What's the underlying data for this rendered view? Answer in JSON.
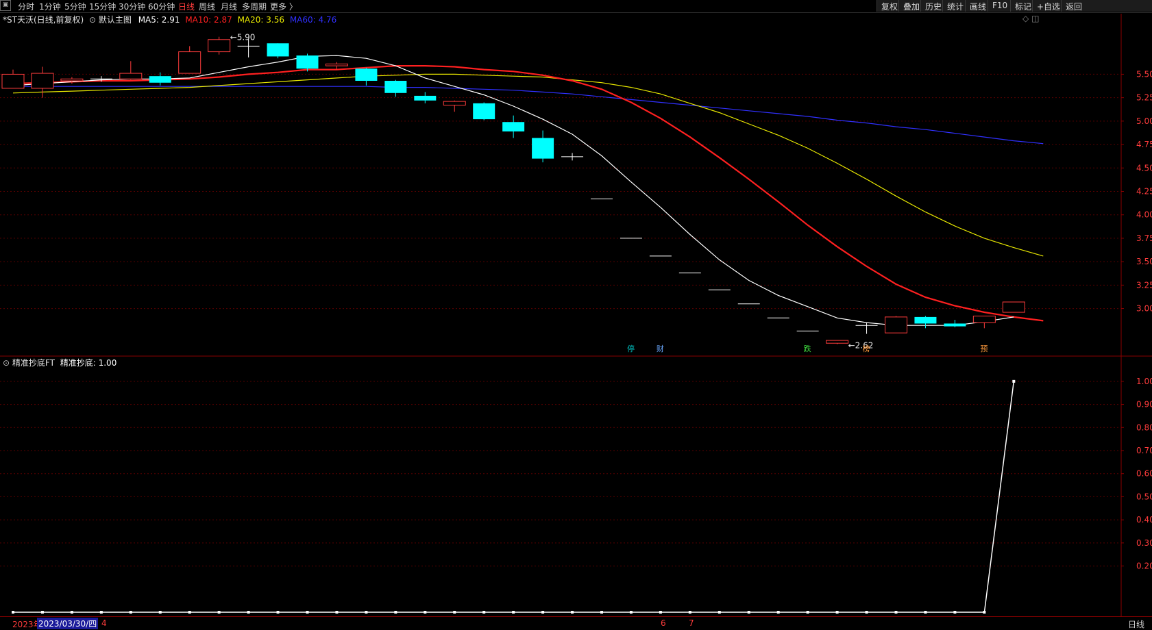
{
  "toolbar": {
    "corner_icon": "panel-toggle-icon",
    "periods": [
      "分时",
      "1分钟",
      "5分钟",
      "15分钟",
      "30分钟",
      "60分钟",
      "日线",
      "周线",
      "月线",
      "多周期",
      "更多 〉"
    ],
    "active_period": "日线",
    "right_buttons": [
      "复权",
      "叠加",
      "历史",
      "统计",
      "画线",
      "F10",
      "标记",
      "+自选",
      "返回"
    ]
  },
  "main_chart": {
    "stock_title": "*ST天沃(日线,前复权)",
    "template_label": "默认主图",
    "ma5": "MA5: 2.91",
    "ma10": "MA10: 2.87",
    "ma20": "MA20: 3.56",
    "ma60": "MA60: 4.76",
    "colors": {
      "ma5": "#ffffff",
      "ma10": "#ff2020",
      "ma20": "#e8e800",
      "ma60": "#3030ff",
      "up": "#ff3c3c",
      "down": "#00ffff",
      "flat": "#ffffff"
    },
    "high_label": "5.90",
    "low_label": "2.62",
    "axis_ticks": [
      "5.50",
      "5.25",
      "5.00",
      "4.75",
      "4.50",
      "4.25",
      "4.00",
      "3.75",
      "3.50",
      "3.25",
      "3.00"
    ],
    "event_markers": [
      {
        "text": "停",
        "color": "#00c0c0"
      },
      {
        "text": "财",
        "color": "#6aa8ff"
      },
      {
        "text": "跌",
        "color": "#40e040"
      },
      {
        "text": "榜",
        "color": "#ff9a3c"
      },
      {
        "text": "预",
        "color": "#ff9a3c"
      }
    ]
  },
  "chart_data": [
    {
      "type": "candlestick",
      "title": "*ST天沃(日线,前复权)",
      "ylim": [
        2.5,
        6.0
      ],
      "candles": [
        {
          "o": 5.35,
          "h": 5.55,
          "l": 5.35,
          "c": 5.5
        },
        {
          "o": 5.35,
          "h": 5.58,
          "l": 5.25,
          "c": 5.51
        },
        {
          "o": 5.43,
          "h": 5.47,
          "l": 5.4,
          "c": 5.45
        },
        {
          "o": 5.45,
          "h": 5.48,
          "l": 5.42,
          "c": 5.45
        },
        {
          "o": 5.45,
          "h": 5.64,
          "l": 5.44,
          "c": 5.51
        },
        {
          "o": 5.48,
          "h": 5.52,
          "l": 5.38,
          "c": 5.41
        },
        {
          "o": 5.51,
          "h": 5.8,
          "l": 5.51,
          "c": 5.74
        },
        {
          "o": 5.74,
          "h": 5.9,
          "l": 5.71,
          "c": 5.87
        },
        {
          "o": 5.8,
          "h": 5.88,
          "l": 5.68,
          "c": 5.8
        },
        {
          "o": 5.83,
          "h": 5.83,
          "l": 5.67,
          "c": 5.69
        },
        {
          "o": 5.7,
          "h": 5.72,
          "l": 5.53,
          "c": 5.56
        },
        {
          "o": 5.59,
          "h": 5.63,
          "l": 5.55,
          "c": 5.61
        },
        {
          "o": 5.56,
          "h": 5.57,
          "l": 5.38,
          "c": 5.43
        },
        {
          "o": 5.43,
          "h": 5.44,
          "l": 5.26,
          "c": 5.3
        },
        {
          "o": 5.27,
          "h": 5.31,
          "l": 5.19,
          "c": 5.22
        },
        {
          "o": 5.17,
          "h": 5.22,
          "l": 5.1,
          "c": 5.21
        },
        {
          "o": 5.19,
          "h": 5.2,
          "l": 5.01,
          "c": 5.02
        },
        {
          "o": 4.99,
          "h": 5.06,
          "l": 4.82,
          "c": 4.89
        },
        {
          "o": 4.82,
          "h": 4.9,
          "l": 4.56,
          "c": 4.6
        },
        {
          "o": 4.62,
          "h": 4.66,
          "l": 4.58,
          "c": 4.62
        },
        {
          "o": 4.17,
          "h": 4.17,
          "l": 4.17,
          "c": 4.17
        },
        {
          "o": 3.75,
          "h": 3.75,
          "l": 3.75,
          "c": 3.75
        },
        {
          "o": 3.56,
          "h": 3.56,
          "l": 3.56,
          "c": 3.56
        },
        {
          "o": 3.38,
          "h": 3.38,
          "l": 3.38,
          "c": 3.38
        },
        {
          "o": 3.2,
          "h": 3.2,
          "l": 3.2,
          "c": 3.2
        },
        {
          "o": 3.05,
          "h": 3.05,
          "l": 3.05,
          "c": 3.05
        },
        {
          "o": 2.9,
          "h": 2.9,
          "l": 2.9,
          "c": 2.9
        },
        {
          "o": 2.76,
          "h": 2.76,
          "l": 2.76,
          "c": 2.76
        },
        {
          "o": 2.63,
          "h": 2.66,
          "l": 2.62,
          "c": 2.66
        },
        {
          "o": 2.82,
          "h": 2.85,
          "l": 2.73,
          "c": 2.82
        },
        {
          "o": 2.74,
          "h": 2.92,
          "l": 2.74,
          "c": 2.91
        },
        {
          "o": 2.91,
          "h": 2.92,
          "l": 2.79,
          "c": 2.84
        },
        {
          "o": 2.84,
          "h": 2.88,
          "l": 2.8,
          "c": 2.81
        },
        {
          "o": 2.85,
          "h": 2.92,
          "l": 2.79,
          "c": 2.92
        },
        {
          "o": 2.96,
          "h": 3.07,
          "l": 2.96,
          "c": 3.07
        }
      ],
      "ma5": [
        5.38,
        5.4,
        5.42,
        5.44,
        5.45,
        5.45,
        5.46,
        5.52,
        5.58,
        5.63,
        5.69,
        5.7,
        5.67,
        5.59,
        5.46,
        5.37,
        5.28,
        5.16,
        5.02,
        4.86,
        4.63,
        4.35,
        4.08,
        3.79,
        3.52,
        3.3,
        3.14,
        3.02,
        2.9,
        2.85,
        2.82,
        2.82,
        2.82,
        2.86,
        2.91
      ],
      "ma10": [
        5.4,
        5.41,
        5.42,
        5.43,
        5.43,
        5.44,
        5.45,
        5.47,
        5.5,
        5.52,
        5.55,
        5.55,
        5.57,
        5.59,
        5.59,
        5.58,
        5.55,
        5.53,
        5.49,
        5.43,
        5.34,
        5.2,
        5.03,
        4.83,
        4.61,
        4.38,
        4.14,
        3.89,
        3.66,
        3.45,
        3.26,
        3.12,
        3.03,
        2.96,
        2.91,
        2.87
      ],
      "ma20": [
        5.3,
        5.31,
        5.32,
        5.33,
        5.34,
        5.35,
        5.36,
        5.38,
        5.4,
        5.42,
        5.44,
        5.46,
        5.48,
        5.49,
        5.5,
        5.5,
        5.49,
        5.48,
        5.47,
        5.44,
        5.41,
        5.36,
        5.29,
        5.19,
        5.09,
        4.97,
        4.85,
        4.71,
        4.55,
        4.38,
        4.2,
        4.03,
        3.88,
        3.75,
        3.65,
        3.56
      ],
      "ma60": [
        5.37,
        5.37,
        5.37,
        5.37,
        5.37,
        5.37,
        5.37,
        5.37,
        5.37,
        5.37,
        5.37,
        5.37,
        5.37,
        5.36,
        5.36,
        5.35,
        5.34,
        5.33,
        5.31,
        5.29,
        5.26,
        5.23,
        5.2,
        5.17,
        5.14,
        5.11,
        5.08,
        5.05,
        5.01,
        4.98,
        4.94,
        4.91,
        4.87,
        4.83,
        4.79,
        4.76
      ]
    },
    {
      "type": "line",
      "title": "精准抄底FT",
      "series": [
        {
          "name": "精准抄底",
          "values": [
            0,
            0,
            0,
            0,
            0,
            0,
            0,
            0,
            0,
            0,
            0,
            0,
            0,
            0,
            0,
            0,
            0,
            0,
            0,
            0,
            0,
            0,
            0,
            0,
            0,
            0,
            0,
            0,
            0,
            0,
            0,
            0,
            0,
            0,
            1
          ]
        }
      ],
      "ylim": [
        0,
        1.05
      ]
    }
  ],
  "indicator_panel": {
    "name": "精准抄底FT",
    "value_label": "精准抄底: 1.00",
    "axis_ticks": [
      "1.00",
      "0.90",
      "0.80",
      "0.70",
      "0.60",
      "0.50",
      "0.40",
      "0.30",
      "0.20"
    ]
  },
  "status_bar": {
    "year_label": "2023年",
    "cursor_date": "2023/03/30/四",
    "month_marks": [
      "4",
      "6",
      "7"
    ],
    "period_label": "日线"
  }
}
